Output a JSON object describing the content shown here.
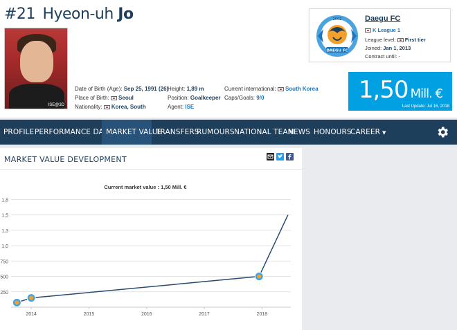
{
  "player": {
    "number": "#21",
    "first_name": "Hyeon-uh",
    "last_name": "Jo",
    "photo_tag": "ISE@3D",
    "details": {
      "dob_label": "Date of Birth (Age):",
      "dob_value": "Sep 25, 1991 (26)",
      "pob_label": "Place of Birth:",
      "pob_value": "Seoul",
      "nationality_label": "Nationality:",
      "nationality_value": "Korea, South",
      "height_label": "Height:",
      "height_value": "1,89 m",
      "position_label": "Position:",
      "position_value": "Goalkeeper",
      "agent_label": "Agent:",
      "agent_value": "ISE",
      "intl_label": "Current international:",
      "intl_value": "South Korea",
      "caps_label": "Caps/Goals:",
      "caps_value": "9/0"
    }
  },
  "club": {
    "name": "Daegu FC",
    "league": "K League 1",
    "league_level_label": "League level:",
    "league_level_value": "First tier",
    "joined_label": "Joined:",
    "joined_value": "Jan 1, 2013",
    "contract_label": "Contract until:",
    "contract_value": "-",
    "logo_text": "DAEGU FC",
    "logo_year": "2002"
  },
  "market_value": {
    "value": "1,50",
    "unit": "Mill. €",
    "last_update": "Last Update: Jul 16, 2018"
  },
  "nav": {
    "items": [
      {
        "label": "Profile",
        "caret": ""
      },
      {
        "label": "Performance data",
        "caret": "▼"
      },
      {
        "label": "Market value",
        "caret": ""
      },
      {
        "label": "Transfers",
        "caret": ""
      },
      {
        "label": "Rumours",
        "caret": ""
      },
      {
        "label": "National team",
        "caret": ""
      },
      {
        "label": "News",
        "caret": ""
      },
      {
        "label": "Honours",
        "caret": ""
      },
      {
        "label": "Career",
        "caret": "▼"
      }
    ],
    "active_index": 2
  },
  "panel": {
    "title": "Market value development"
  },
  "colors": {
    "navy": "#1d3f5c",
    "accent_blue": "#00a1e3",
    "line": "#2b4a6f"
  },
  "chart_data": {
    "type": "line",
    "title": "Current market value : 1,50 Mill. €",
    "xlabel": "",
    "ylabel": "",
    "x_ticks": [
      "2014",
      "2015",
      "2016",
      "2017",
      "2018"
    ],
    "y_ticks": [
      "250",
      "500",
      "750",
      "1,0",
      "1,3",
      "1,5",
      "1,8"
    ],
    "y_tick_values": [
      250,
      500,
      750,
      1000,
      1250,
      1500,
      1750
    ],
    "ylim": [
      0,
      1800
    ],
    "xlim": [
      2013.65,
      2018.5
    ],
    "grid": true,
    "series": [
      {
        "x": [
          2013.75,
          2014.0,
          2017.95,
          2018.45
        ],
        "values": [
          75,
          150,
          500,
          1500
        ],
        "marker_points": [
          0,
          1,
          2
        ]
      }
    ]
  }
}
